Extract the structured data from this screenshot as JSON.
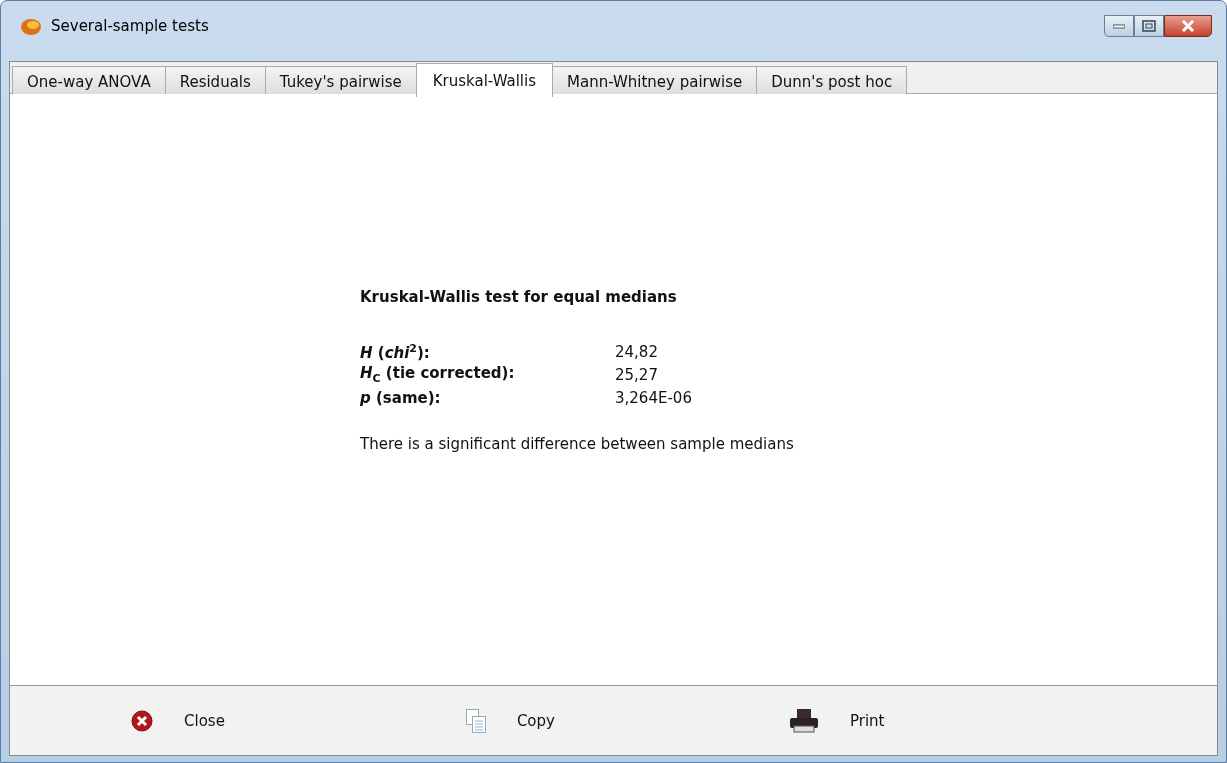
{
  "window": {
    "title": "Several-sample tests"
  },
  "tabs": [
    {
      "label": "One-way ANOVA",
      "selected": false
    },
    {
      "label": "Residuals",
      "selected": false
    },
    {
      "label": "Tukey's pairwise",
      "selected": false
    },
    {
      "label": "Kruskal-Wallis",
      "selected": true
    },
    {
      "label": "Mann-Whitney pairwise",
      "selected": false
    },
    {
      "label": "Dunn's post hoc",
      "selected": false
    }
  ],
  "result": {
    "heading": "Kruskal-Wallis test for equal medians",
    "rows": [
      {
        "label": "*H* (*chi*$^{2}$):",
        "value": "24,82"
      },
      {
        "label": "*H*$_{C}$ (tie corrected):",
        "value": "25,27"
      },
      {
        "label": "*p* (same):",
        "value": "3,264E-06"
      }
    ],
    "conclusion": "There is a significant difference between sample medians"
  },
  "buttons": [
    {
      "kind": "close",
      "label": "Close"
    },
    {
      "kind": "copy",
      "label": "Copy"
    },
    {
      "kind": "print",
      "label": "Print"
    }
  ]
}
